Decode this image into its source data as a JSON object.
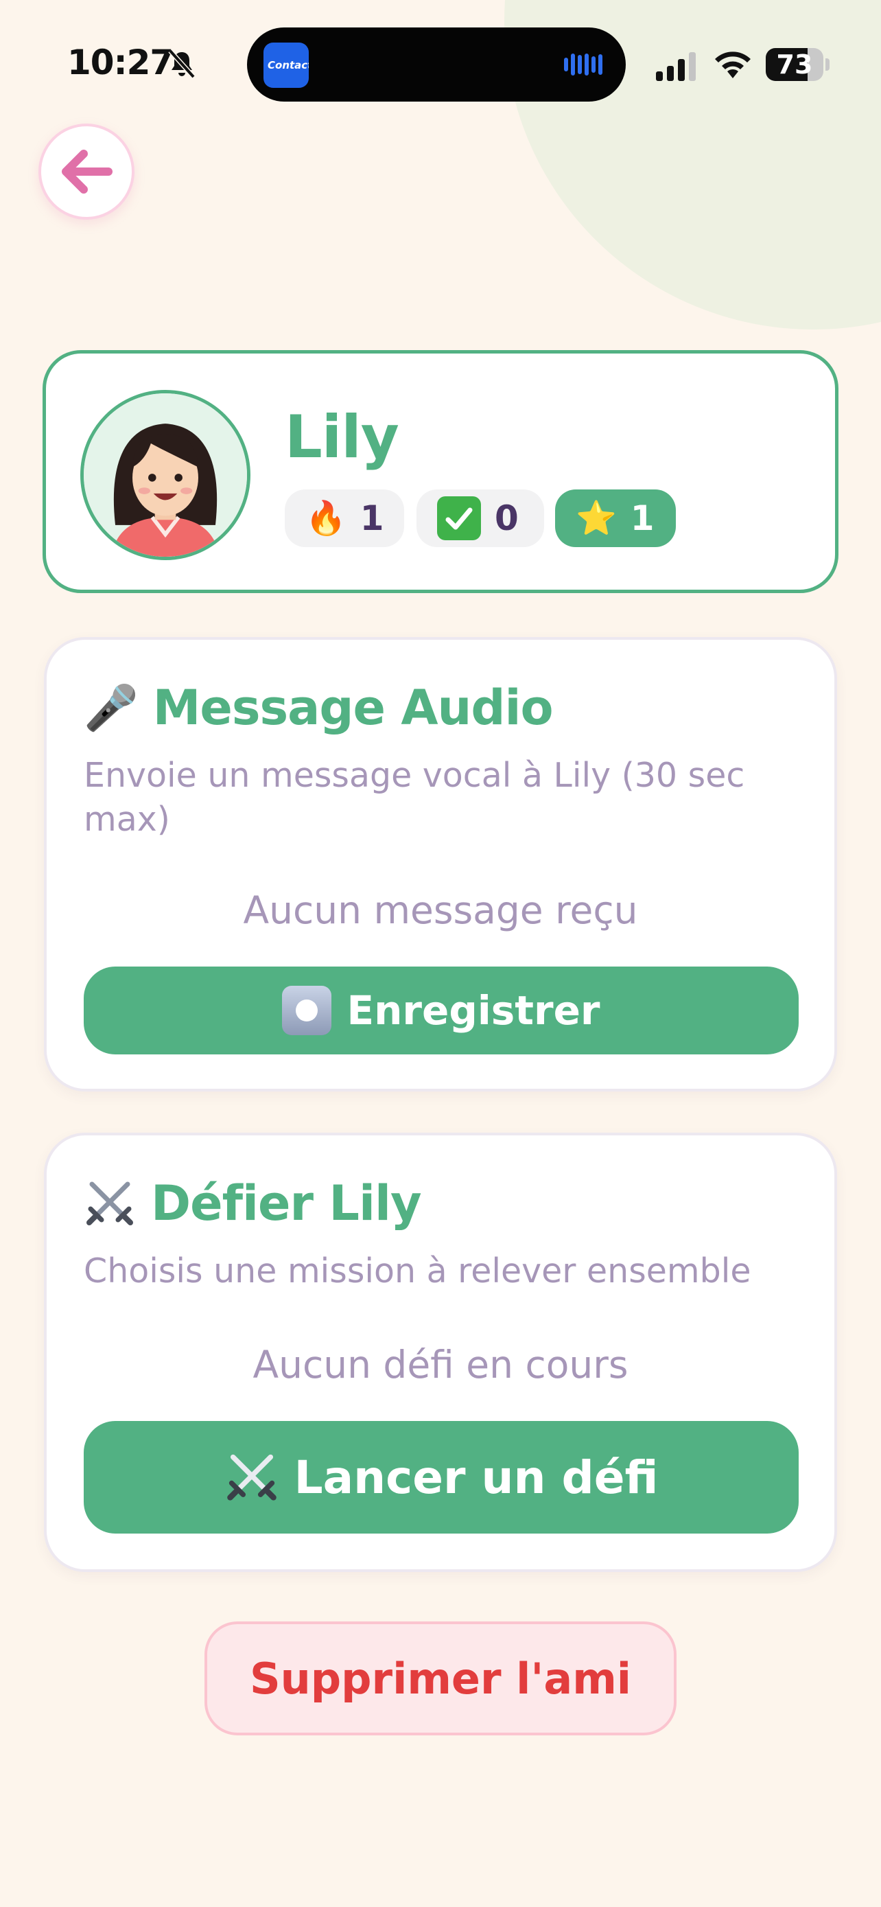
{
  "status_bar": {
    "time": "10:27",
    "battery_level": "73",
    "battery_fraction": 0.73,
    "island_app_label": "Contact"
  },
  "header": {
    "back_icon": "arrow-left-icon"
  },
  "profile": {
    "name": "Lily",
    "stats": [
      {
        "icon": "🔥",
        "icon_name": "fire-icon",
        "value": "1"
      },
      {
        "icon": "✅",
        "icon_name": "checkmark-icon",
        "value": "0"
      },
      {
        "icon": "⭐",
        "icon_name": "star-icon",
        "value": "1"
      }
    ]
  },
  "audio_card": {
    "icon": "🎤",
    "title": "Message Audio",
    "subtitle": "Envoie un message vocal à Lily (30 sec max)",
    "empty_text": "Aucun message reçu",
    "record_label": "Enregistrer"
  },
  "challenge_card": {
    "title": "Défier Lily",
    "subtitle": "Choisis une mission à relever ensemble",
    "empty_text": "Aucun défi en cours",
    "launch_label": "Lancer un défi"
  },
  "delete_label": "Supprimer l'ami",
  "colors": {
    "accent_green": "#52b183",
    "background": "#fdf5ec",
    "muted_text": "#a696b8",
    "danger_red": "#e23d3d",
    "danger_bg": "#fde8ea",
    "back_pink": "#e070a8"
  }
}
